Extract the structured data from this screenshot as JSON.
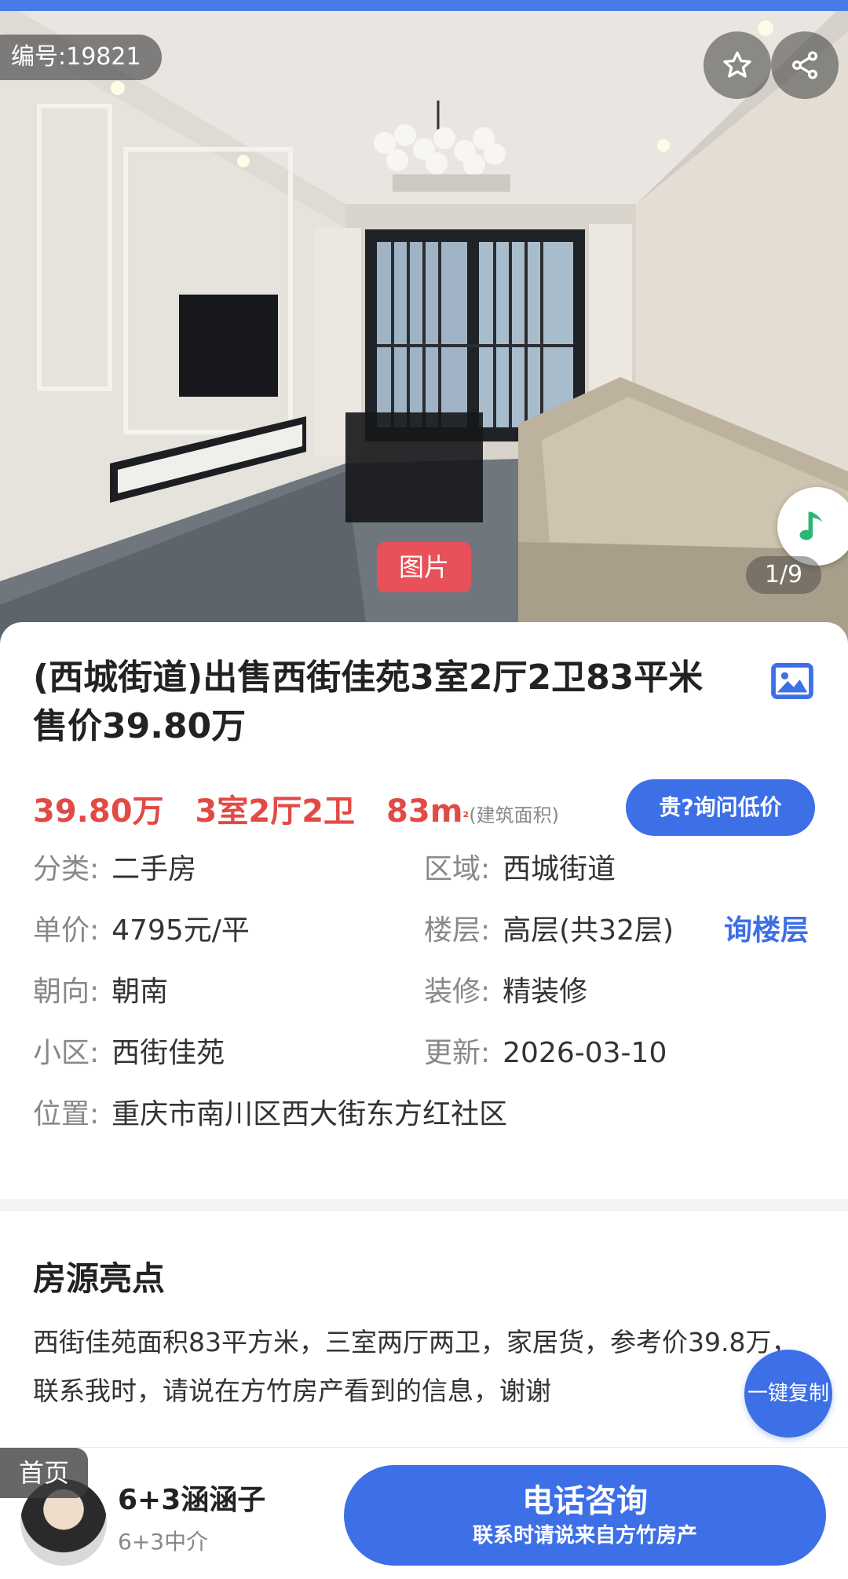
{
  "hero": {
    "listing_code": "编号:19821",
    "photo_tag": "图片",
    "photo_counter": "1/9",
    "icons": {
      "favorite": "star-outline-icon",
      "share": "share-icon",
      "music": "music-note-icon"
    },
    "colors": {
      "photo_tag": "#e8505a"
    }
  },
  "listing": {
    "title": "(西城街道)出售西街佳苑3室2厅2卫83平米 售价39.80万",
    "price": "39.80万",
    "layout": "3室2厅2卫",
    "area": "83m",
    "area_unit_sup": "²",
    "area_note": "(建筑面积)",
    "ask_price_button": "贵?询问低价",
    "ask_floor_link": "询楼层",
    "gallery_icon": "gallery-image-icon",
    "colors": {
      "price": "#e24a45",
      "accent": "#3d6fe6"
    },
    "attributes": {
      "category": {
        "label": "分类:",
        "value": "二手房"
      },
      "region": {
        "label": "区域:",
        "value": "西城街道"
      },
      "unit_price": {
        "label": "单价:",
        "value": "4795元/平"
      },
      "floor": {
        "label": "楼层:",
        "value": "高层(共32层)"
      },
      "orientation": {
        "label": "朝向:",
        "value": "朝南"
      },
      "decoration": {
        "label": "装修:",
        "value": "精装修"
      },
      "community": {
        "label": "小区:",
        "value": "西街佳苑"
      },
      "updated": {
        "label": "更新:",
        "value": "2026-03-10"
      },
      "location": {
        "label": "位置:",
        "value": "重庆市南川区西大街东方红社区"
      }
    }
  },
  "highlights": {
    "title": "房源亮点",
    "text": "西街佳苑面积83平方米，三室两厅两卫，家居货，参考价39.8万，联系我时，请说在方竹房产看到的信息，谢谢",
    "copy_button": "一键复制"
  },
  "bottom_bar": {
    "home_tag": "首页",
    "agent_name": "6+3涵涵子",
    "agent_company": "6+3中介",
    "call_button": "电话咨询",
    "call_subtext": "联系时请说来自方竹房产"
  }
}
